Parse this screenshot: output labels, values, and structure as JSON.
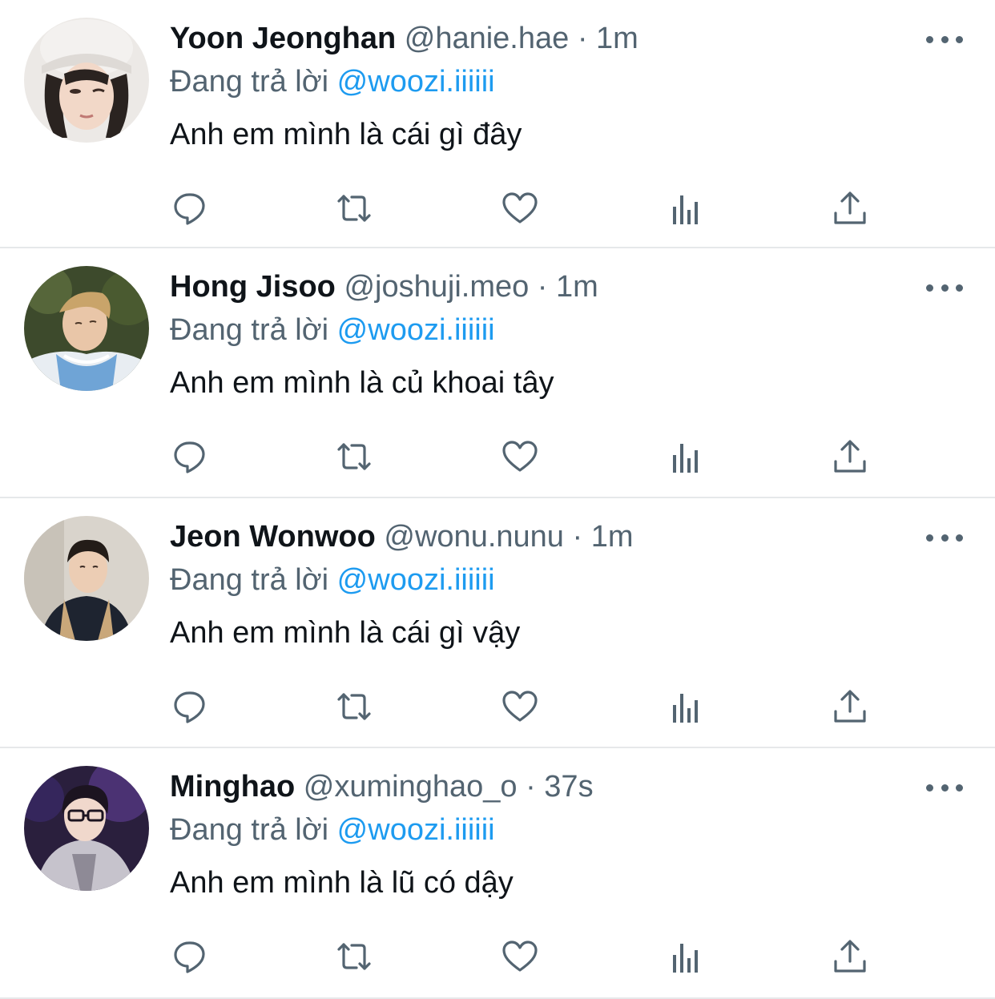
{
  "colors": {
    "mention": "#1d9bf0",
    "secondary_text": "#536471",
    "primary_text": "#0f1419",
    "divider": "#e6e8ea"
  },
  "tweets": [
    {
      "name": "Yoon Jeonghan",
      "handle": "@hanie.hae",
      "sep": " · ",
      "time": "1m",
      "reply_prefix": "Đang trả lời ",
      "reply_to": "@woozi.iiiiii",
      "text": "Anh em mình là cái gì đây",
      "avatar_icon": "avatar-image"
    },
    {
      "name": "Hong Jisoo",
      "handle": "@joshuji.meo",
      "sep": " · ",
      "time": "1m",
      "reply_prefix": "Đang trả lời ",
      "reply_to": "@woozi.iiiiii",
      "text": "Anh em mình là củ khoai tây",
      "avatar_icon": "avatar-image"
    },
    {
      "name": "Jeon Wonwoo",
      "handle": "@wonu.nunu",
      "sep": " · ",
      "time": "1m",
      "reply_prefix": "Đang trả lời ",
      "reply_to": "@woozi.iiiiii",
      "text": "Anh em mình là cái gì vậy",
      "avatar_icon": "avatar-image"
    },
    {
      "name": "Minghao",
      "handle": "@xuminghao_o",
      "sep": " · ",
      "time": "37s",
      "reply_prefix": "Đang trả lời ",
      "reply_to": "@woozi.iiiiii",
      "text": "Anh em mình là lũ có dậy",
      "avatar_icon": "avatar-image"
    }
  ],
  "action_icons": [
    "reply-icon",
    "retweet-icon",
    "like-icon",
    "views-icon",
    "share-icon"
  ],
  "more_icon": "more-options-icon"
}
